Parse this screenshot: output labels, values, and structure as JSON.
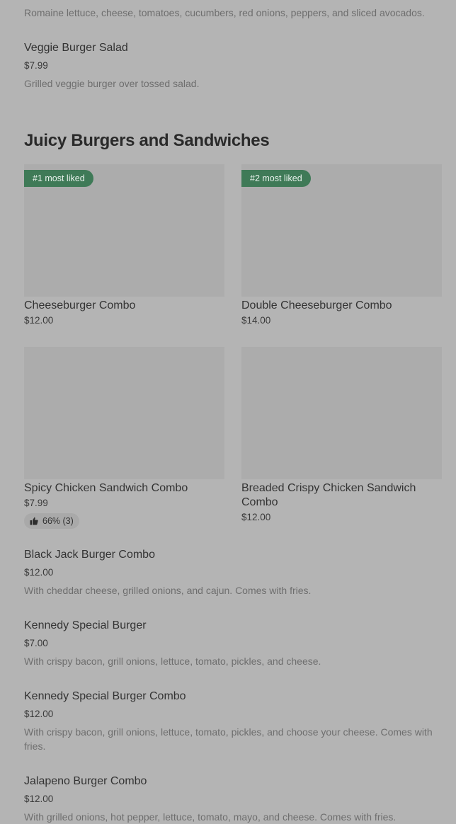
{
  "top_item": {
    "description": "Romaine lettuce, cheese, tomatoes, cucumbers, red onions, peppers, and sliced avocados."
  },
  "veggie_salad": {
    "name": "Veggie Burger Salad",
    "price": "$7.99",
    "description": "Grilled veggie burger over tossed salad."
  },
  "section": {
    "title": "Juicy Burgers and Sandwiches"
  },
  "cards": [
    {
      "badge": "#1 most liked",
      "name": "Cheeseburger Combo",
      "price": "$12.00"
    },
    {
      "badge": "#2 most liked",
      "name": "Double Cheeseburger Combo",
      "price": "$14.00"
    },
    {
      "name": "Spicy Chicken Sandwich Combo",
      "price": "$7.99",
      "rating": "66% (3)"
    },
    {
      "name": "Breaded Crispy Chicken Sandwich Combo",
      "price": "$12.00"
    }
  ],
  "list_items": [
    {
      "name": "Black Jack Burger Combo",
      "price": "$12.00",
      "description": "With cheddar cheese, grilled onions, and cajun. Comes with fries."
    },
    {
      "name": "Kennedy Special Burger",
      "price": "$7.00",
      "description": "With crispy bacon, grill onions, lettuce, tomato, pickles, and cheese."
    },
    {
      "name": "Kennedy Special Burger Combo",
      "price": "$12.00",
      "description": "With crispy bacon, grill onions, lettuce, tomato, pickles, and choose your cheese. Comes with fries."
    },
    {
      "name": "Jalapeno Burger Combo",
      "price": "$12.00",
      "description": "With grilled onions, hot pepper, lettuce, tomato, mayo, and cheese. Comes with fries."
    }
  ]
}
